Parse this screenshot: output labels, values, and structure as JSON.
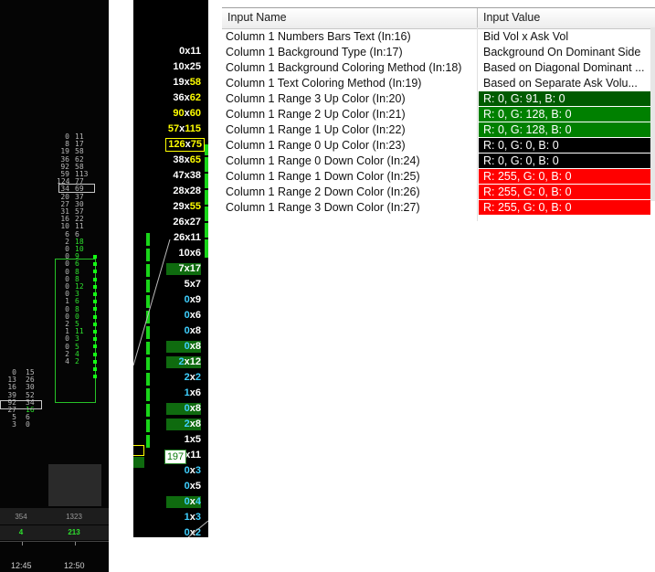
{
  "left_chart": {
    "col_a": [
      "0",
      "8",
      "19",
      "36",
      "92",
      "59",
      "124",
      "34",
      "20",
      "27",
      "31",
      "16",
      "10",
      "6",
      "2",
      "0",
      "0",
      "0",
      "0",
      "0",
      "0",
      "0",
      "1",
      "0",
      "0",
      "2",
      "1",
      "0",
      "0",
      "2",
      "4"
    ],
    "col_b": [
      "11",
      "17",
      "58",
      "62",
      "58",
      "113",
      "77",
      "69",
      "37",
      "30",
      "57",
      "22",
      "11",
      "6",
      "18",
      "10",
      "9",
      "6",
      "8",
      "8",
      "12",
      "3",
      "6",
      "8",
      "0",
      "5",
      "11",
      "3",
      "5",
      "4",
      "2"
    ],
    "col_c": [
      "0",
      "13",
      "16",
      "39",
      "92",
      "27",
      "5",
      "3"
    ],
    "col_d": [
      "15",
      "26",
      "30",
      "52",
      "34",
      "16",
      "6",
      "0"
    ],
    "bottom_vols": [
      "354",
      "1323"
    ],
    "bottom_deltas": [
      "4",
      "213"
    ],
    "times": [
      "12:45",
      "12:50"
    ]
  },
  "mid_chart": {
    "rows": [
      {
        "l": "0",
        "r": "11",
        "lc": "#ffffff",
        "rc": "#ffffff",
        "bg": ""
      },
      {
        "l": "10",
        "r": "25",
        "lc": "#ffffff",
        "rc": "#ffffff",
        "bg": ""
      },
      {
        "l": "19",
        "r": "58",
        "lc": "#ffffff",
        "rc": "#ffff00",
        "bg": ""
      },
      {
        "l": "36",
        "r": "62",
        "lc": "#ffffff",
        "rc": "#ffff00",
        "bg": ""
      },
      {
        "l": "90",
        "r": "60",
        "lc": "#ffff00",
        "rc": "#ffff00",
        "bg": ""
      },
      {
        "l": "57",
        "r": "115",
        "lc": "#ffff00",
        "rc": "#ffff00",
        "bg": ""
      },
      {
        "l": "126",
        "r": "75",
        "lc": "#ffff00",
        "rc": "#ffff00",
        "bg": "",
        "boxed": true
      },
      {
        "l": "38",
        "r": "65",
        "lc": "#ffffff",
        "rc": "#ffff00",
        "bg": ""
      },
      {
        "l": "47",
        "r": "38",
        "lc": "#ffffff",
        "rc": "#ffffff",
        "bg": ""
      },
      {
        "l": "28",
        "r": "28",
        "lc": "#ffffff",
        "rc": "#ffffff",
        "bg": ""
      },
      {
        "l": "29",
        "r": "55",
        "lc": "#ffffff",
        "rc": "#ffff00",
        "bg": ""
      },
      {
        "l": "26",
        "r": "27",
        "lc": "#ffffff",
        "rc": "#ffffff",
        "bg": ""
      },
      {
        "l": "26",
        "r": "11",
        "lc": "#ffffff",
        "rc": "#ffffff",
        "bg": ""
      },
      {
        "l": "10",
        "r": "6",
        "lc": "#ffffff",
        "rc": "#ffffff",
        "bg": ""
      },
      {
        "l": "7",
        "r": "17",
        "lc": "#ffffff",
        "rc": "#ffffff",
        "bg": "#0f6b0f"
      },
      {
        "l": "5",
        "r": "7",
        "lc": "#ffffff",
        "rc": "#ffffff",
        "bg": ""
      },
      {
        "l": "0",
        "r": "9",
        "lc": "#3fd0ff",
        "rc": "#ffffff",
        "bg": ""
      },
      {
        "l": "0",
        "r": "6",
        "lc": "#3fd0ff",
        "rc": "#ffffff",
        "bg": ""
      },
      {
        "l": "0",
        "r": "8",
        "lc": "#3fd0ff",
        "rc": "#ffffff",
        "bg": ""
      },
      {
        "l": "0",
        "r": "8",
        "lc": "#3fd0ff",
        "rc": "#ffffff",
        "bg": "#0f6b0f"
      },
      {
        "l": "2",
        "r": "12",
        "lc": "#3fd0ff",
        "rc": "#ffffff",
        "bg": "#0f6b0f"
      },
      {
        "l": "2",
        "r": "2",
        "lc": "#3fd0ff",
        "rc": "#3fd0ff",
        "bg": ""
      },
      {
        "l": "1",
        "r": "6",
        "lc": "#3fd0ff",
        "rc": "#ffffff",
        "bg": ""
      },
      {
        "l": "0",
        "r": "8",
        "lc": "#3fd0ff",
        "rc": "#ffffff",
        "bg": "#0f6b0f"
      },
      {
        "l": "2",
        "r": "8",
        "lc": "#3fd0ff",
        "rc": "#ffffff",
        "bg": "#0f6b0f"
      },
      {
        "l": "1",
        "r": "5",
        "lc": "#ffffff",
        "rc": "#ffffff",
        "bg": ""
      },
      {
        "l": "0",
        "r": "11",
        "lc": "#3fd0ff",
        "rc": "#ffffff",
        "bg": ""
      },
      {
        "l": "0",
        "r": "3",
        "lc": "#3fd0ff",
        "rc": "#3fd0ff",
        "bg": ""
      },
      {
        "l": "0",
        "r": "5",
        "lc": "#3fd0ff",
        "rc": "#ffffff",
        "bg": ""
      },
      {
        "l": "0",
        "r": "4",
        "lc": "#3fd0ff",
        "rc": "#3fd0ff",
        "bg": "#0f6b0f"
      },
      {
        "l": "1",
        "r": "3",
        "lc": "#3fd0ff",
        "rc": "#3fd0ff",
        "bg": ""
      },
      {
        "l": "0",
        "r": "2",
        "lc": "#3fd0ff",
        "rc": "#3fd0ff",
        "bg": ""
      }
    ],
    "total": "197"
  },
  "table": {
    "header_name": "Input Name",
    "header_value": "Input Value",
    "rows": [
      {
        "name": "Column 1 Numbers Bars Text   (In:16)",
        "value": "Bid Vol x Ask Vol",
        "color": ""
      },
      {
        "name": "Column 1 Background Type   (In:17)",
        "value": "Background On Dominant Side",
        "color": ""
      },
      {
        "name": "Column 1 Background Coloring Method   (In:18)",
        "value": "Based on Diagonal Dominant ...",
        "color": ""
      },
      {
        "name": "Column 1 Text Coloring Method   (In:19)",
        "value": "Based on Separate Ask Volu...",
        "color": ""
      },
      {
        "name": "Column 1 Range 3 Up Color   (In:20)",
        "value": "R: 0, G: 91, B: 0",
        "color": "#005b00"
      },
      {
        "name": "Column 1 Range 2 Up Color   (In:21)",
        "value": "R: 0, G: 128, B: 0",
        "color": "#008000"
      },
      {
        "name": "Column 1 Range 1 Up Color   (In:22)",
        "value": "R: 0, G: 128, B: 0",
        "color": "#008000"
      },
      {
        "name": "Column 1 Range 0 Up Color   (In:23)",
        "value": "R: 0, G: 0, B: 0",
        "color": "#000000"
      },
      {
        "name": "Column 1 Range 0 Down Color   (In:24)",
        "value": "R: 0, G: 0, B: 0",
        "color": "#000000"
      },
      {
        "name": "Column 1 Range 1 Down Color   (In:25)",
        "value": "R: 255, G: 0, B: 0",
        "color": "#ff0000"
      },
      {
        "name": "Column 1 Range 2 Down Color   (In:26)",
        "value": "R: 255, G: 0, B: 0",
        "color": "#ff0000"
      },
      {
        "name": "Column 1 Range 3 Down Color   (In:27)",
        "value": "R: 255, G: 0, B: 0",
        "color": "#ff0000"
      }
    ]
  }
}
